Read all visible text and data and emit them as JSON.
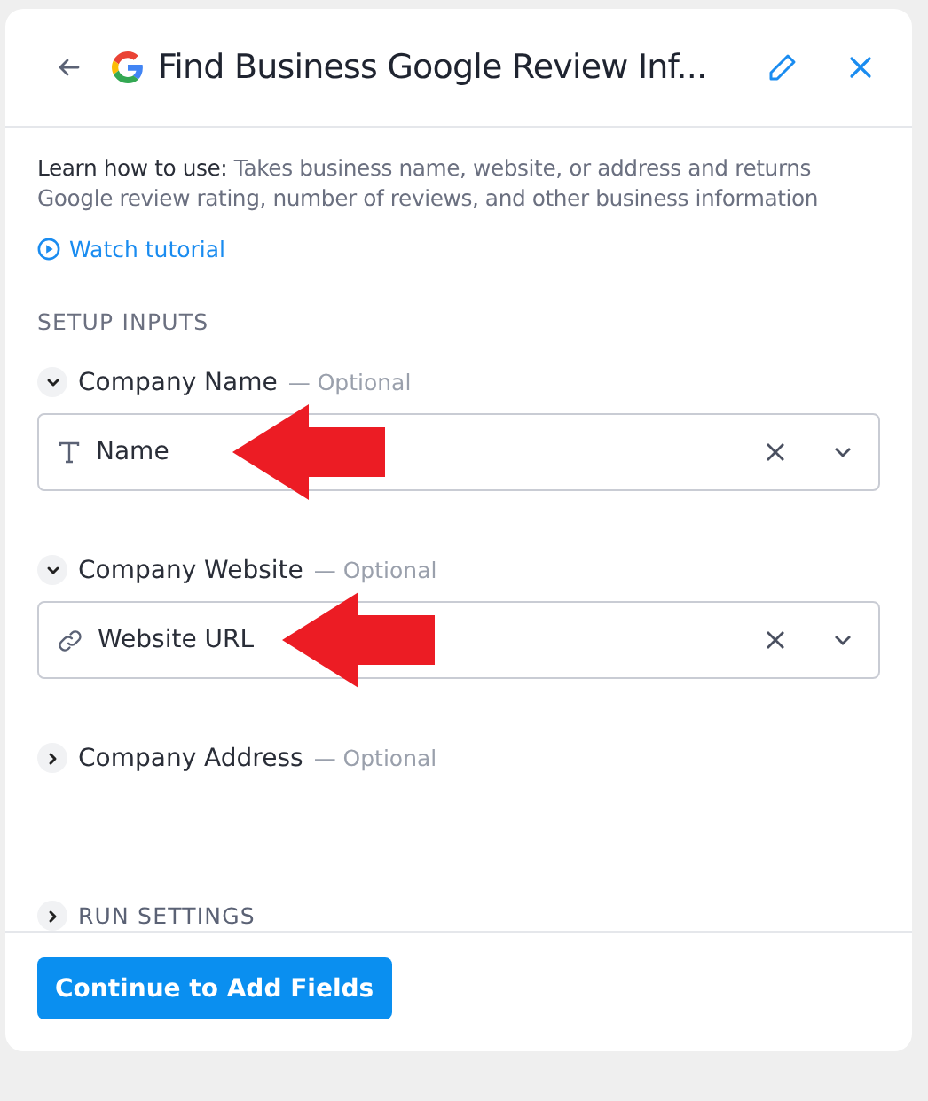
{
  "header": {
    "title": "Find Business Google Review Inf..."
  },
  "description": {
    "lead": "Learn how to use:",
    "text": "Takes business name, website, or address and returns Google review rating, number of reviews, and other business information"
  },
  "tutorial_link": "Watch tutorial",
  "section_title": "SETUP INPUTS",
  "inputs": [
    {
      "label": "Company Name",
      "hint": "— Optional",
      "expanded": true,
      "kind": "text",
      "value": "Name",
      "highlighted": true
    },
    {
      "label": "Company Website",
      "hint": "— Optional",
      "expanded": true,
      "kind": "link",
      "value": "Website URL",
      "highlighted": true
    },
    {
      "label": "Company Address",
      "hint": "— Optional",
      "expanded": false
    }
  ],
  "run_settings": {
    "label": "RUN SETTINGS",
    "expanded": false
  },
  "primary_button": "Continue to Add Fields"
}
